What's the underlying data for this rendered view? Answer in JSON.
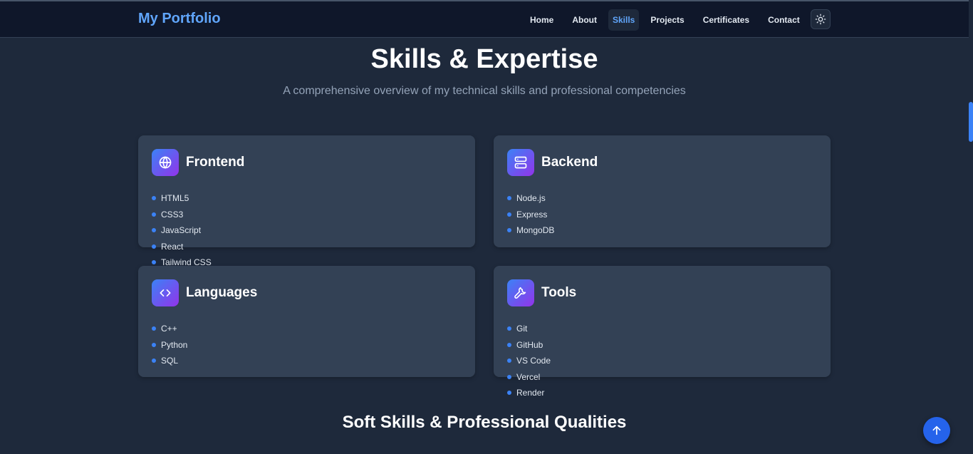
{
  "nav": {
    "brand": "My Portfolio",
    "links": [
      "Home",
      "About",
      "Skills",
      "Projects",
      "Certificates",
      "Contact"
    ],
    "active": "Skills",
    "theme_toggle_icon": "sun-icon"
  },
  "hero": {
    "title": "Skills & Expertise",
    "subtitle": "A comprehensive overview of my technical skills and professional competencies"
  },
  "cards": [
    {
      "title": "Frontend",
      "icon": "globe-icon",
      "skills": [
        "HTML5",
        "CSS3",
        "JavaScript",
        "React",
        "Tailwind CSS"
      ]
    },
    {
      "title": "Backend",
      "icon": "server-icon",
      "skills": [
        "Node.js",
        "Express",
        "MongoDB"
      ]
    },
    {
      "title": "Languages",
      "icon": "code-icon",
      "skills": [
        "C++",
        "Python",
        "SQL"
      ]
    },
    {
      "title": "Tools",
      "icon": "wrench-icon",
      "skills": [
        "Git",
        "GitHub",
        "VS Code",
        "Vercel",
        "Render"
      ]
    }
  ],
  "soft_skills": {
    "title": "Soft Skills & Professional Qualities"
  },
  "colors": {
    "accent": "#3b82f6",
    "brand": "#60a5fa",
    "background": "#1e293b",
    "card": "#334155",
    "navbar": "#0f172a"
  },
  "scroll_top_icon": "arrow-up-icon"
}
